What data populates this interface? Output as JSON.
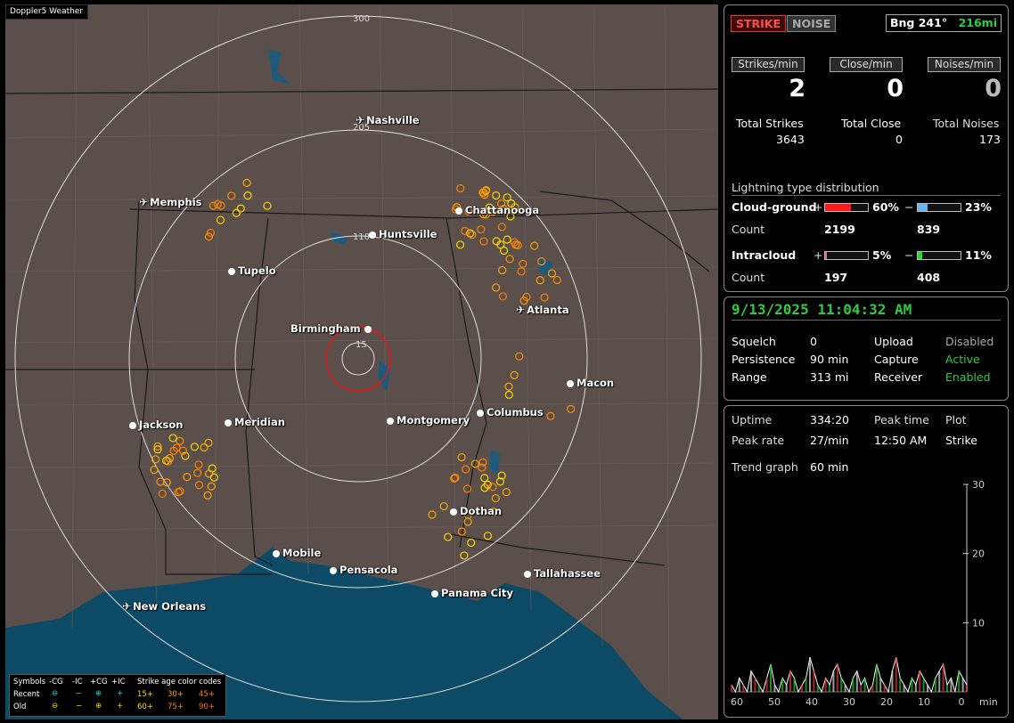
{
  "app_title": "Doppler5 Weather",
  "map": {
    "ring_labels": [
      "300",
      "205",
      "110",
      "15"
    ],
    "cities": [
      {
        "name": "Nashville",
        "airport": true
      },
      {
        "name": "Memphis",
        "airport": true
      },
      {
        "name": "Chattanooga",
        "airport": false
      },
      {
        "name": "Huntsville",
        "airport": false
      },
      {
        "name": "Tupelo",
        "airport": false
      },
      {
        "name": "Atlanta",
        "airport": true
      },
      {
        "name": "Birmingham",
        "airport": false
      },
      {
        "name": "Macon",
        "airport": false
      },
      {
        "name": "Jackson",
        "airport": false
      },
      {
        "name": "Meridian",
        "airport": false
      },
      {
        "name": "Montgomery",
        "airport": false
      },
      {
        "name": "Columbus",
        "airport": false
      },
      {
        "name": "Dothan",
        "airport": false
      },
      {
        "name": "Mobile",
        "airport": false
      },
      {
        "name": "Pensacola",
        "airport": false
      },
      {
        "name": "Tallahassee",
        "airport": false
      },
      {
        "name": "Panama City",
        "airport": false
      },
      {
        "name": "New Orleans",
        "airport": true
      }
    ],
    "legend": {
      "symbols_title": "Symbols",
      "columns": [
        "-CG",
        "-IC",
        "+CG",
        "+IC"
      ],
      "rows": [
        "Recent",
        "Old"
      ],
      "age_title": "Strike age color codes",
      "recent_ages": [
        "15+",
        "30+",
        "45+"
      ],
      "old_ages": [
        "60+",
        "75+",
        "90+"
      ]
    }
  },
  "colors": {
    "age15": "#ffd700",
    "age30": "#ffa500",
    "age45": "#ff7f00",
    "age60": "#ffd700",
    "age75": "#ff8c00",
    "age90": "#ff6a00",
    "recent_cyan": "#22d3d3",
    "status_green": "#2ecc40"
  },
  "panel1": {
    "strike_btn": "STRIKE",
    "noise_btn": "NOISE",
    "bearing": "Bng 241°",
    "distance": "216mi",
    "strikes_per_min_label": "Strikes/min",
    "close_per_min_label": "Close/min",
    "noises_per_min_label": "Noises/min",
    "strikes_per_min": "2",
    "close_per_min": "0",
    "noises_per_min": "0",
    "total_strikes_label": "Total Strikes",
    "total_close_label": "Total Close",
    "total_noises_label": "Total Noises",
    "total_strikes": "3643",
    "total_close": "0",
    "total_noises": "173",
    "dist_title": "Lightning type distribution",
    "cg_label": "Cloud-ground",
    "ic_label": "Intracloud",
    "count_label": "Count",
    "plus": "+",
    "minus": "−",
    "cg_pos_pct": "60%",
    "cg_neg_pct": "23%",
    "cg_pos_count": "2199",
    "cg_neg_count": "839",
    "ic_pos_pct": "5%",
    "ic_neg_pct": "11%",
    "ic_pos_count": "197",
    "ic_neg_count": "408"
  },
  "panel2": {
    "datetime": "9/13/2025 11:04:32 AM",
    "squelch_label": "Squelch",
    "squelch": "0",
    "persistence_label": "Persistence",
    "persistence": "90 min",
    "range_label": "Range",
    "range": "313 mi",
    "upload_label": "Upload",
    "upload": "Disabled",
    "capture_label": "Capture",
    "capture": "Active",
    "receiver_label": "Receiver",
    "receiver": "Enabled"
  },
  "panel3": {
    "uptime_label": "Uptime",
    "uptime": "334:20",
    "peak_time_label": "Peak time",
    "plot_label": "Plot",
    "peak_rate_label": "Peak rate",
    "peak_rate": "27/min",
    "peak_time": "12:50 AM",
    "plot": "Strike",
    "trend_label": "Trend graph",
    "trend": "60 min"
  },
  "chart_data": {
    "type": "area",
    "x_ticks": [
      "60",
      "50",
      "40",
      "30",
      "20",
      "10",
      "0"
    ],
    "x_unit": "min",
    "y_ticks": [
      "30",
      "20",
      "10"
    ],
    "ylim": [
      0,
      30
    ],
    "values": [
      1,
      0,
      2,
      1,
      0,
      3,
      2,
      1,
      0,
      2,
      4,
      1,
      0,
      2,
      1,
      3,
      2,
      0,
      1,
      2,
      5,
      3,
      1,
      0,
      2,
      1,
      3,
      4,
      2,
      1,
      0,
      2,
      3,
      1,
      2,
      0,
      1,
      4,
      2,
      1,
      0,
      3,
      5,
      2,
      1,
      0,
      2,
      1,
      3,
      2,
      1,
      0,
      2,
      3,
      4,
      1,
      2,
      0,
      3,
      2,
      1
    ]
  }
}
